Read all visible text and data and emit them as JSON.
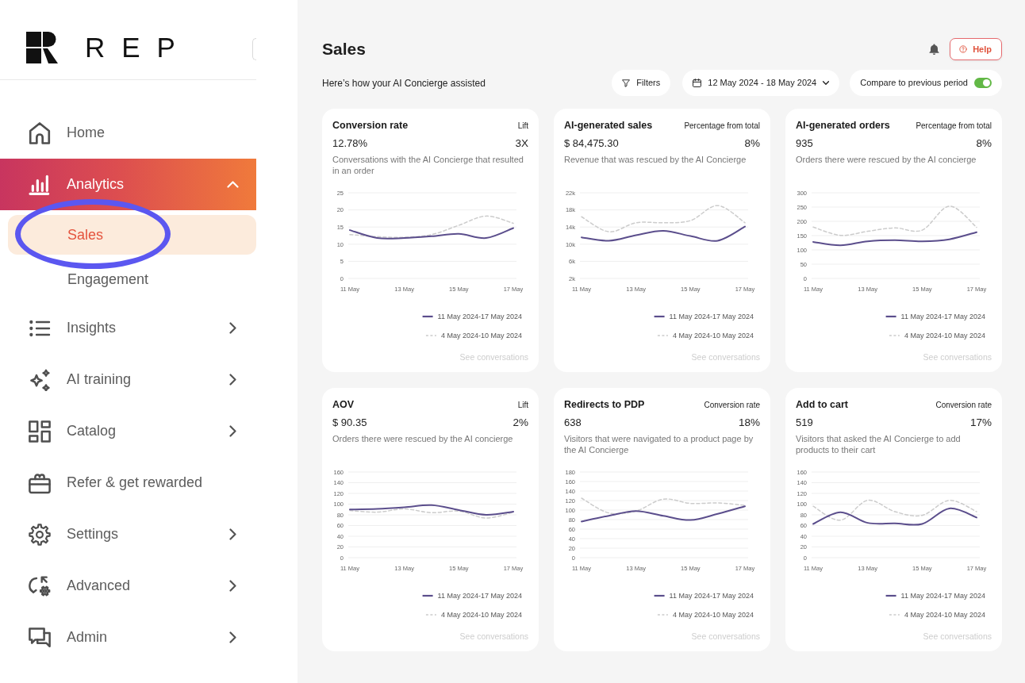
{
  "sidebar": {
    "logo_text": "REP",
    "items": [
      {
        "label": "Home",
        "kind": "link",
        "selected": false
      },
      {
        "label": "Analytics",
        "kind": "group",
        "selected": true,
        "expanded": true,
        "children": [
          {
            "label": "Sales",
            "selected": true,
            "circled": true
          },
          {
            "label": "Engagement",
            "selected": false,
            "circled": false
          }
        ]
      },
      {
        "label": "Insights",
        "kind": "group",
        "selected": false,
        "expanded": false
      },
      {
        "label": "AI training",
        "kind": "group",
        "selected": false,
        "expanded": false
      },
      {
        "label": "Catalog",
        "kind": "group",
        "selected": false,
        "expanded": false
      },
      {
        "label": "Refer & get rewarded",
        "kind": "link",
        "selected": false
      },
      {
        "label": "Settings",
        "kind": "group",
        "selected": false,
        "expanded": false
      },
      {
        "label": "Advanced",
        "kind": "group",
        "selected": false,
        "expanded": false
      },
      {
        "label": "Admin",
        "kind": "group",
        "selected": false,
        "expanded": false
      }
    ]
  },
  "header": {
    "title": "Sales",
    "help_button": "Help",
    "subtitle": "Here’s how your AI Concierge assisted",
    "filters_button": "Filters",
    "date_range": "12 May 2024 - 18 May 2024",
    "compare_toggle": {
      "label": "Compare to previous period",
      "on": true
    }
  },
  "cards": [
    {
      "title": "Conversion rate",
      "metric_label": "Lift",
      "value": "12.78%",
      "metric_value": "3X",
      "description": "Conversations with the AI Concierge that resulted in an order",
      "link": "See conversations",
      "chart_data": {
        "type": "line",
        "categories": [
          "11 May",
          null,
          "13 May",
          null,
          "15 May",
          null,
          "17 May"
        ],
        "ylim": [
          0,
          25
        ],
        "yticks": [
          0,
          5,
          10,
          15,
          20,
          25
        ],
        "grid": true,
        "legend": "bottom",
        "series": [
          {
            "name": "11 May 2024-17 May 2024",
            "color": "#5b4e8c",
            "values": [
              14.1,
              11.8,
              11.8,
              12.3,
              13,
              11.8,
              14.7
            ]
          },
          {
            "name": "4 May 2024-10 May 2024",
            "color": "#cccccc",
            "line_style": "dashed",
            "values": [
              12.8,
              12.2,
              12,
              12.8,
              15.5,
              18.2,
              16.1
            ]
          }
        ]
      }
    },
    {
      "title": "AI-generated sales",
      "metric_label": "Percentage from total",
      "value": "$ 84,475.30",
      "metric_value": "8%",
      "description": "Revenue that was rescued by the AI Concierge",
      "link": "See conversations",
      "chart_data": {
        "type": "line",
        "categories": [
          "11 May",
          null,
          "13 May",
          null,
          "15 May",
          null,
          "17 May"
        ],
        "ylim": [
          2000,
          22000
        ],
        "yticks": [
          {
            "value": 2000,
            "label": "2k"
          },
          {
            "value": 6000,
            "label": "6k"
          },
          {
            "value": 10000,
            "label": "10k"
          },
          {
            "value": 14000,
            "label": "14k"
          },
          {
            "value": 18000,
            "label": "18k"
          },
          {
            "value": 22000,
            "label": "22k"
          }
        ],
        "grid": true,
        "legend": "bottom",
        "series": [
          {
            "name": "11 May 2024-17 May 2024",
            "color": "#5b4e8c",
            "values": [
              11600,
              10800,
              12100,
              13100,
              11900,
              10800,
              14100
            ]
          },
          {
            "name": "4 May 2024-10 May 2024",
            "color": "#cccccc",
            "line_style": "dashed",
            "values": [
              16400,
              12900,
              15000,
              15000,
              15500,
              19000,
              15000
            ]
          }
        ]
      }
    },
    {
      "title": "AI-generated orders",
      "metric_label": "Percentage from total",
      "value": "935",
      "metric_value": "8%",
      "description": "Orders there were rescued by the AI concierge",
      "link": "See conversations",
      "chart_data": {
        "type": "line",
        "categories": [
          "11 May",
          null,
          "13 May",
          null,
          "15 May",
          null,
          "17 May"
        ],
        "ylim": [
          0,
          300
        ],
        "yticks": [
          0,
          50,
          100,
          150,
          200,
          250,
          300
        ],
        "grid": true,
        "legend": "bottom",
        "series": [
          {
            "name": "11 May 2024-17 May 2024",
            "color": "#5b4e8c",
            "values": [
              128,
              116,
              130,
              134,
              130,
              137,
              162
            ]
          },
          {
            "name": "4 May 2024-10 May 2024",
            "color": "#cccccc",
            "line_style": "dashed",
            "values": [
              180,
              151,
              165,
              177,
              169,
              253,
              179
            ]
          }
        ]
      }
    },
    {
      "title": "AOV",
      "metric_label": "Lift",
      "value": "$ 90.35",
      "metric_value": "2%",
      "description": "Orders there were rescued by the AI concierge",
      "link": "See conversations",
      "chart_data": {
        "type": "line",
        "categories": [
          "11 May",
          null,
          "13 May",
          null,
          "15 May",
          null,
          "17 May"
        ],
        "ylim": [
          0,
          160
        ],
        "yticks": [
          0,
          20,
          40,
          60,
          80,
          100,
          120,
          140,
          160
        ],
        "grid": true,
        "legend": "bottom",
        "series": [
          {
            "name": "11 May 2024-17 May 2024",
            "color": "#5b4e8c",
            "values": [
              90,
              91,
              94,
              98,
              89,
              80,
              86
            ]
          },
          {
            "name": "4 May 2024-10 May 2024",
            "color": "#cccccc",
            "line_style": "dashed",
            "values": [
              88,
              85,
              91,
              84,
              87,
              74,
              85
            ]
          }
        ]
      }
    },
    {
      "title": "Redirects to PDP",
      "metric_label": "Conversion rate",
      "value": "638",
      "metric_value": "18%",
      "description": "Visitors that were navigated to a product page by the AI Concierge",
      "link": "See conversations",
      "chart_data": {
        "type": "line",
        "categories": [
          "11 May",
          null,
          "13 May",
          null,
          "15 May",
          null,
          "17 May"
        ],
        "ylim": [
          0,
          180
        ],
        "yticks": [
          0,
          20,
          40,
          60,
          80,
          100,
          120,
          140,
          160,
          180
        ],
        "grid": true,
        "legend": "bottom",
        "series": [
          {
            "name": "11 May 2024-17 May 2024",
            "color": "#5b4e8c",
            "values": [
              76,
              88,
              98,
              88,
              79,
              92,
              108
            ]
          },
          {
            "name": "4 May 2024-10 May 2024",
            "color": "#cccccc",
            "line_style": "dashed",
            "values": [
              125,
              94,
              98,
              123,
              114,
              115,
              110
            ]
          }
        ]
      }
    },
    {
      "title": "Add to cart",
      "metric_label": "Conversion rate",
      "value": "519",
      "metric_value": "17%",
      "description": "Visitors that asked the AI Concierge to add products to their cart",
      "link": "See conversations",
      "chart_data": {
        "type": "line",
        "categories": [
          "11 May",
          null,
          "13 May",
          null,
          "15 May",
          null,
          "17 May"
        ],
        "ylim": [
          0,
          160
        ],
        "yticks": [
          0,
          20,
          40,
          60,
          80,
          100,
          120,
          140,
          160
        ],
        "grid": true,
        "legend": "bottom",
        "series": [
          {
            "name": "11 May 2024-17 May 2024",
            "color": "#5b4e8c",
            "values": [
              63,
              85,
              65,
              64,
              63,
              92,
              75
            ]
          },
          {
            "name": "4 May 2024-10 May 2024",
            "color": "#cccccc",
            "line_style": "dashed",
            "values": [
              96,
              70,
              107,
              86,
              79,
              107,
              86
            ]
          }
        ]
      }
    }
  ]
}
